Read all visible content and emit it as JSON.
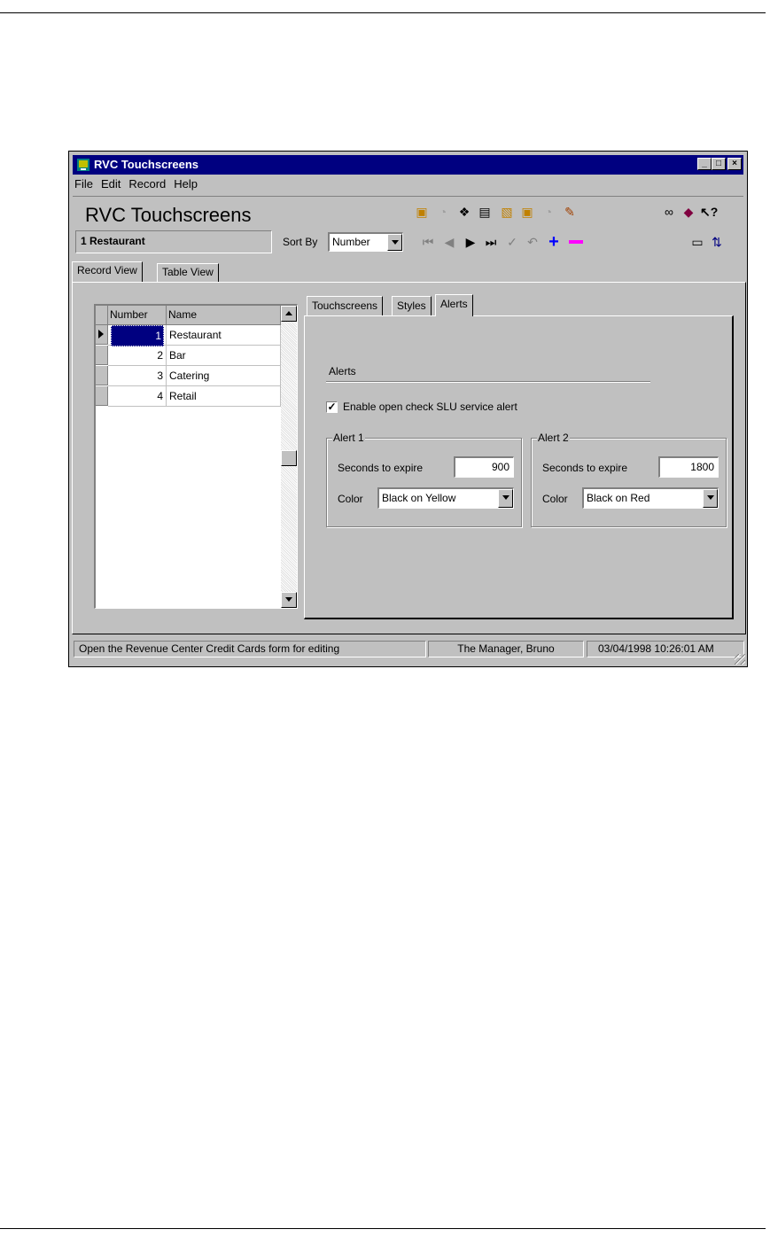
{
  "window": {
    "title": "RVC Touchscreens",
    "menu": [
      "File",
      "Edit",
      "Record",
      "Help"
    ]
  },
  "header": {
    "app_title": "RVC Touchscreens",
    "current_record": "1 Restaurant",
    "sort_by_label": "Sort By",
    "sort_by_value": "Number"
  },
  "toolbar_icons": [
    "copy-record-icon",
    "paste-record-icon",
    "find-record-icon",
    "delete-icon",
    "clipboard-icon",
    "copy-icon",
    "paste-icon",
    "edit-icon",
    "find-icon",
    "book-icon",
    "help-pointer-icon",
    "first-record-icon",
    "prev-record-icon",
    "next-record-icon",
    "last-record-icon",
    "save-check-icon",
    "undo-icon",
    "add-record-icon",
    "delete-record-icon",
    "monitor-icon",
    "refresh-icon"
  ],
  "tabs": [
    "Record View",
    "Table View"
  ],
  "grid": {
    "headers": [
      "Number",
      "Name"
    ],
    "rows": [
      {
        "number": "1",
        "name": "Restaurant"
      },
      {
        "number": "2",
        "name": "Bar"
      },
      {
        "number": "3",
        "name": "Catering"
      },
      {
        "number": "4",
        "name": "Retail"
      }
    ]
  },
  "subtabs": [
    "Touchscreens",
    "Styles",
    "Alerts"
  ],
  "alerts": {
    "section_title": "Alerts",
    "enable_label": "Enable open check SLU service alert",
    "enable_checked": true,
    "alert1": {
      "title": "Alert 1",
      "seconds_label": "Seconds to expire",
      "seconds": "900",
      "color_label": "Color",
      "color": "Black on Yellow"
    },
    "alert2": {
      "title": "Alert 2",
      "seconds_label": "Seconds to expire",
      "seconds": "1800",
      "color_label": "Color",
      "color": "Black on Red"
    }
  },
  "status": {
    "message": "Open the Revenue Center Credit Cards form for editing",
    "user": "The Manager, Bruno",
    "datetime": "03/04/1998 10:26:01 AM"
  },
  "colors": {
    "titlebar": "#000080",
    "face": "#c0c0c0",
    "selection": "#000080"
  }
}
